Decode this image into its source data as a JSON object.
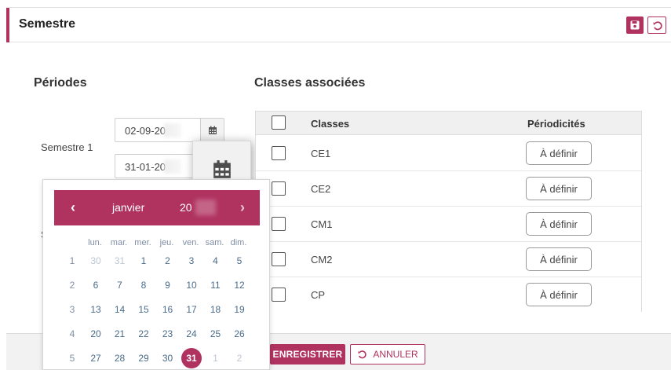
{
  "header": {
    "title": "Semestre"
  },
  "periods": {
    "title": "Périodes",
    "semester1_label": "Semestre 1",
    "semester2_label_partial": "S",
    "semester1_start": "02-09-20",
    "semester1_end": "31-01-20"
  },
  "classes": {
    "title": "Classes associées",
    "col_classes": "Classes",
    "col_periodicites": "Périodicités",
    "rows": [
      {
        "name": "CE1",
        "action": "À définir"
      },
      {
        "name": "CE2",
        "action": "À définir"
      },
      {
        "name": "CM1",
        "action": "À définir"
      },
      {
        "name": "CM2",
        "action": "À définir"
      },
      {
        "name": "CP",
        "action": "À définir"
      }
    ]
  },
  "footer": {
    "save_label": "ENREGISTRER",
    "cancel_label": "ANNULER"
  },
  "datepicker": {
    "month": "janvier",
    "year": "20",
    "prev": "‹",
    "next": "›",
    "weekdays": [
      "lun.",
      "mar.",
      "mer.",
      "jeu.",
      "ven.",
      "sam.",
      "dim."
    ],
    "weeks": [
      {
        "num": "1",
        "days": [
          {
            "d": "30",
            "other": true
          },
          {
            "d": "31",
            "other": true
          },
          {
            "d": "1"
          },
          {
            "d": "2"
          },
          {
            "d": "3"
          },
          {
            "d": "4"
          },
          {
            "d": "5"
          }
        ]
      },
      {
        "num": "2",
        "days": [
          {
            "d": "6"
          },
          {
            "d": "7"
          },
          {
            "d": "8"
          },
          {
            "d": "9"
          },
          {
            "d": "10"
          },
          {
            "d": "11"
          },
          {
            "d": "12"
          }
        ]
      },
      {
        "num": "3",
        "days": [
          {
            "d": "13"
          },
          {
            "d": "14"
          },
          {
            "d": "15"
          },
          {
            "d": "16"
          },
          {
            "d": "17"
          },
          {
            "d": "18"
          },
          {
            "d": "19"
          }
        ]
      },
      {
        "num": "4",
        "days": [
          {
            "d": "20"
          },
          {
            "d": "21"
          },
          {
            "d": "22"
          },
          {
            "d": "23"
          },
          {
            "d": "24"
          },
          {
            "d": "25"
          },
          {
            "d": "26"
          }
        ]
      },
      {
        "num": "5",
        "days": [
          {
            "d": "27"
          },
          {
            "d": "28"
          },
          {
            "d": "29"
          },
          {
            "d": "30"
          },
          {
            "d": "31",
            "selected": true
          },
          {
            "d": "1",
            "other": true
          },
          {
            "d": "2",
            "other": true
          }
        ]
      }
    ]
  },
  "colors": {
    "accent": "#b0325f",
    "day_text": "#4a6b8a",
    "muted": "#7f8ea3"
  }
}
